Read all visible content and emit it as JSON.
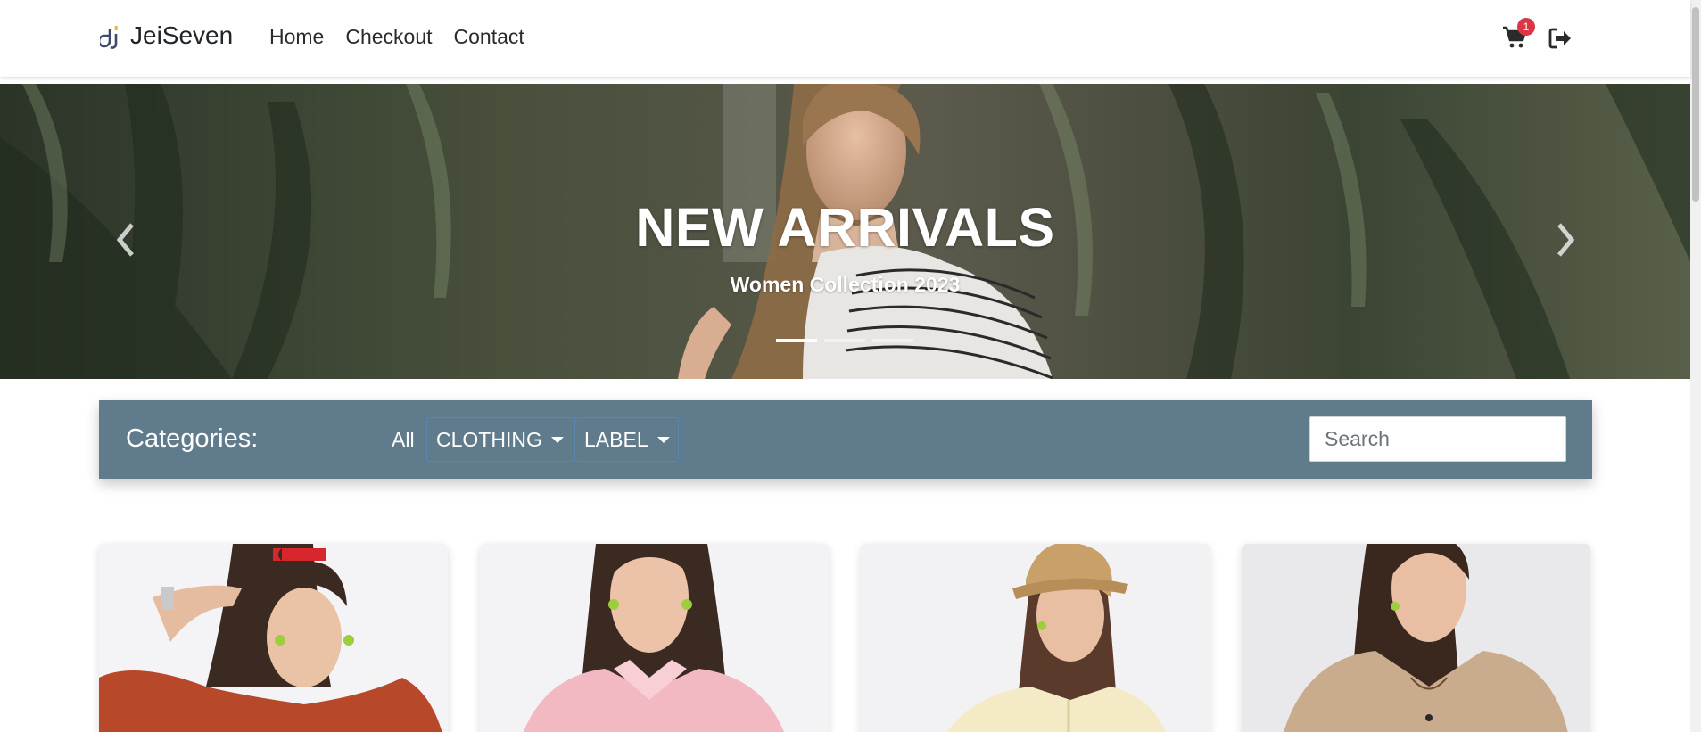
{
  "nav": {
    "brand": "JeiSeven",
    "links": [
      "Home",
      "Checkout",
      "Contact"
    ],
    "cart_count": "1",
    "icons": [
      "cart-icon",
      "logout-icon"
    ]
  },
  "hero": {
    "title": "NEW ARRIVALS",
    "subtitle": "Women Collection 2023",
    "slide_count": 3,
    "active_slide": 1
  },
  "filters": {
    "label": "Categories:",
    "all": "All",
    "clothing": "CLOTHING",
    "label_dropdown": "LABEL",
    "search_placeholder": "Search"
  },
  "colors": {
    "category_bar": "#607b8b",
    "badge": "#dc3545",
    "text_dark": "#212529"
  },
  "products": [
    {
      "garment_color": "#b8482a"
    },
    {
      "garment_color": "#f2b9c2"
    },
    {
      "garment_color": "#f4ebc6"
    },
    {
      "garment_color": "#c9ab8e"
    }
  ]
}
